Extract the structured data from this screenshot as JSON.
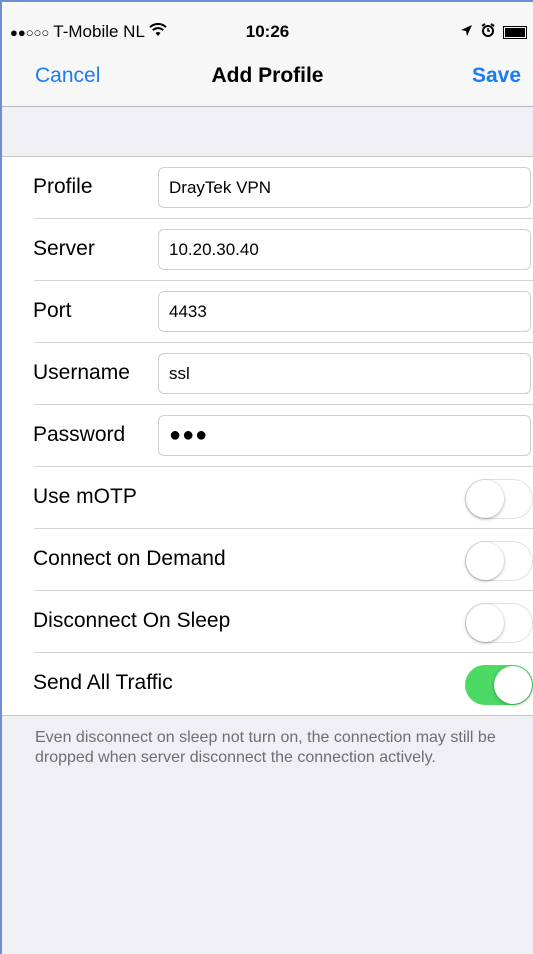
{
  "status_bar": {
    "signal_dots": "●●○○○",
    "carrier": "T-Mobile NL",
    "wifi_icon": "wifi-icon",
    "time": "10:26",
    "location_icon": "location-arrow-icon",
    "alarm_icon": "alarm-clock-icon",
    "battery_icon": "battery-icon"
  },
  "nav": {
    "cancel_label": "Cancel",
    "title": "Add Profile",
    "save_label": "Save",
    "accent_color": "#1a7cf5"
  },
  "fields": {
    "profile": {
      "label": "Profile",
      "value": "DrayTek VPN"
    },
    "server": {
      "label": "Server",
      "value": "10.20.30.40"
    },
    "port": {
      "label": "Port",
      "value": "4433"
    },
    "username": {
      "label": "Username",
      "value": "ssl"
    },
    "password": {
      "label": "Password",
      "value": "●●●"
    }
  },
  "toggles": {
    "use_motp": {
      "label": "Use mOTP",
      "on": false
    },
    "connect_on_demand": {
      "label": "Connect on Demand",
      "on": false
    },
    "disconnect_on_sleep": {
      "label": "Disconnect On Sleep",
      "on": false
    },
    "send_all_traffic": {
      "label": "Send All Traffic",
      "on": true,
      "on_color": "#4cd964"
    }
  },
  "footer_note": "Even disconnect on sleep not turn on, the connection may still be dropped when server disconnect the connection actively."
}
